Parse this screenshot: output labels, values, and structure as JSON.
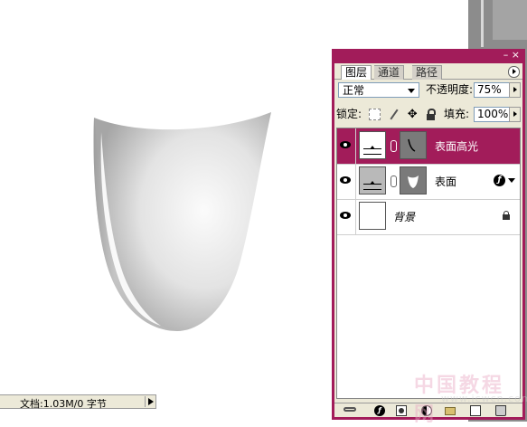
{
  "status_bar": {
    "doc_info": "文档:1.03M/0 字节"
  },
  "layers_panel": {
    "tabs": [
      {
        "label": "图层",
        "active": true
      },
      {
        "label": "通道",
        "active": false
      },
      {
        "label": "路径",
        "active": false
      }
    ],
    "blend_mode": "正常",
    "opacity_label": "不透明度:",
    "opacity_value": "75%",
    "lock_label": "锁定:",
    "fill_label": "填充:",
    "fill_value": "100%",
    "layers": [
      {
        "name": "表面高光",
        "visible": true,
        "selected": true,
        "has_mask": true,
        "has_fx": false
      },
      {
        "name": "表面",
        "visible": true,
        "selected": false,
        "has_mask": true,
        "has_fx": true
      },
      {
        "name": "背景",
        "visible": true,
        "selected": false,
        "has_mask": false,
        "locked": true
      }
    ]
  },
  "watermark": {
    "text": "中国教程网",
    "url": "www.jcwcn.com"
  },
  "colors": {
    "panel_accent": "#a21c5a",
    "panel_bg": "#ece9d8"
  }
}
